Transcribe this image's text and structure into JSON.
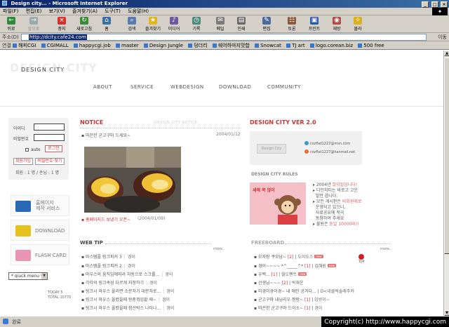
{
  "window": {
    "title": "Design city... - Microsoft Internet Explorer",
    "buttons": [
      "_",
      "□",
      "×"
    ]
  },
  "menu": [
    "파일(F)",
    "편집(E)",
    "보기(V)",
    "즐겨찾기(A)",
    "도구(T)",
    "도움말(H)"
  ],
  "toolbar": [
    {
      "label": "뒤로",
      "icon": "back-arrow-icon",
      "enabled": true
    },
    {
      "label": "앞으로",
      "icon": "forward-arrow-icon",
      "enabled": false
    },
    {
      "label": "중지",
      "icon": "stop-icon",
      "enabled": true
    },
    {
      "label": "새로고침",
      "icon": "refresh-icon",
      "enabled": true
    },
    {
      "label": "홈",
      "icon": "home-icon",
      "enabled": true
    },
    {
      "label": "검색",
      "icon": "search-icon",
      "enabled": true
    },
    {
      "label": "즐겨찾기",
      "icon": "favorites-icon",
      "enabled": true
    },
    {
      "label": "미디어",
      "icon": "media-icon",
      "enabled": true
    },
    {
      "label": "기록",
      "icon": "history-icon",
      "enabled": true
    },
    {
      "label": "메일",
      "icon": "mail-icon",
      "enabled": true
    },
    {
      "label": "인쇄",
      "icon": "print-icon",
      "enabled": true
    },
    {
      "label": "편집",
      "icon": "edit-icon",
      "enabled": true
    },
    {
      "label": "토론",
      "icon": "discuss-icon",
      "enabled": true
    },
    {
      "label": "프린트",
      "icon": "printer-icon",
      "enabled": true
    },
    {
      "label": "재방",
      "icon": "revisit-icon",
      "enabled": true
    },
    {
      "label": "몰라",
      "icon": "bulb-icon",
      "enabled": true
    }
  ],
  "address": {
    "label": "주소(D)",
    "value": "http://dcity.cafe24.com",
    "go": "이동"
  },
  "links": {
    "label": "연결",
    "items": [
      "해피CGI",
      "CGIMALL",
      "happycgi.job",
      "master",
      "Design Jungle",
      "덩더리",
      "쉐어하마지맛합",
      "Snowcat",
      "TJ art",
      "logo.corean.biz",
      "500 free"
    ]
  },
  "site": {
    "logo": "DESIGN CITY",
    "nav": [
      "ABOUT",
      "SERVICE",
      "WEBDESIGN",
      "DOWNLOAD",
      "COMMUNITY"
    ]
  },
  "login": {
    "id_label": "아이디",
    "pw_label": "비밀번호",
    "auto_label": "auto",
    "login_button": "로그인",
    "join_button": "회원가입",
    "find_button": "비밀번호 찾기",
    "member_count": "회원 : 1 명 / 손님 : 1 명"
  },
  "side_buttons": [
    {
      "text": "홈페이지",
      "text2": "제작 서비스",
      "icon": "homepage-service-icon",
      "color": "#2a67b5"
    },
    {
      "text": "DOWNLOAD",
      "text2": "",
      "icon": "download-folder-icon",
      "color": "#e6c21e"
    },
    {
      "text": "FLASH CARD",
      "text2": "",
      "icon": "flash-card-icon",
      "color": "#e894b4"
    }
  ],
  "quick_menu": "* qiuck menu *",
  "counter": {
    "lines": [
      "TODAY   5",
      "TOTAL   10770"
    ]
  },
  "notice": {
    "title": "NOTICE",
    "ghost": "DESIGN CITY NOTICE",
    "top_item": "따끈한 군고구마 드세요~",
    "top_date": "2004/01/12",
    "bottom_item": "홈페이지드 보냈기 오픈~",
    "bottom_date": "(2004/01/09)",
    "color": "#cc3333"
  },
  "webtip": {
    "title": "WEB TIP",
    "more": "more..",
    "rows": [
      {
        "title": "마스템플 링크피커 3",
        "author": "경이"
      },
      {
        "title": "마스템플 링크피커 2",
        "author": "경이"
      },
      {
        "title": "마우스의 움직임에따라 자동으로 스크롤...",
        "author": "경이"
      },
      {
        "title": "각각의 링크속성 다르게 지정하기",
        "author": "경이"
      },
      {
        "title": "링크시 마우스 올리면 소문자가 대문자로...",
        "author": "경이"
      },
      {
        "title": "링크시 마우스 올렸을때 왕중꺾임할 때~",
        "author": "경이"
      },
      {
        "title": "링크시 마우스 올렸을때 점선박스 나타나...",
        "author": "경이"
      }
    ]
  },
  "version": {
    "title": "DESIGN CITY VER 2.0",
    "badge": "Design City",
    "emails": [
      "cozflet1227@msn.com",
      "cozflet1227@hanmail.net"
    ]
  },
  "rules": {
    "title": "DESIGN CITY RULES",
    "image_caption": "새해 복 많이",
    "lines": [
      {
        "text": "2004년 ",
        "hl": "잘이될입니다!",
        "rest": ""
      },
      {
        "text": "디인지티는 바로고 고운",
        "hl": "",
        "rest": ""
      },
      {
        "text": "말만 씁니다.",
        "hl": "",
        "rest": ""
      },
      {
        "text": "모든 게시판은 ",
        "hl": "비회원제로",
        "rest": ""
      },
      {
        "text": "운영되고 있으니,",
        "hl": "",
        "rest": ""
      },
      {
        "text": "자료공유에 적극",
        "hl": "",
        "rest": ""
      },
      {
        "text": "동참하여 주세요",
        "hl": "",
        "rest": ""
      },
      {
        "text": "불원은 ",
        "hl": "톤일 10000대!!",
        "rest": ""
      }
    ]
  },
  "freeboard": {
    "title": "FREEBOARD",
    "more": "more..",
    "top_label": "TOP",
    "rows": [
      {
        "title": "모자랑 쿠모남~",
        "count": "[2]",
        "author": "도이도스",
        "new": true
      },
      {
        "title": "경이~~~~ *^_____^*",
        "count": "[1]",
        "author": "김혜원",
        "new": true
      },
      {
        "title": "우백...",
        "count": "[1]",
        "author": "월도팬트",
        "new": true
      },
      {
        "title": "선생님~~~",
        "count": "[2]",
        "author": "박재운",
        "new": false
      },
      {
        "title": "미경이경이경~ 내 애인 공겨다...",
        "count": "",
        "author": "D<네클럭솔래주커",
        "new": false
      },
      {
        "title": "군고구마 내님리우 짱랑~",
        "count": "[1]",
        "author": "임방이~",
        "new": false
      },
      {
        "title": "따끈한 군고구마 드이소~",
        "count": "[1]",
        "author": "경이",
        "new": false
      }
    ]
  },
  "status": {
    "text": "완료",
    "copyright": "Copyright(c) http://www.happycgi.com"
  },
  "colors": {
    "accent_red": "#cc3333",
    "new_badge": "#e87070",
    "title_blue": "#0a246a"
  }
}
